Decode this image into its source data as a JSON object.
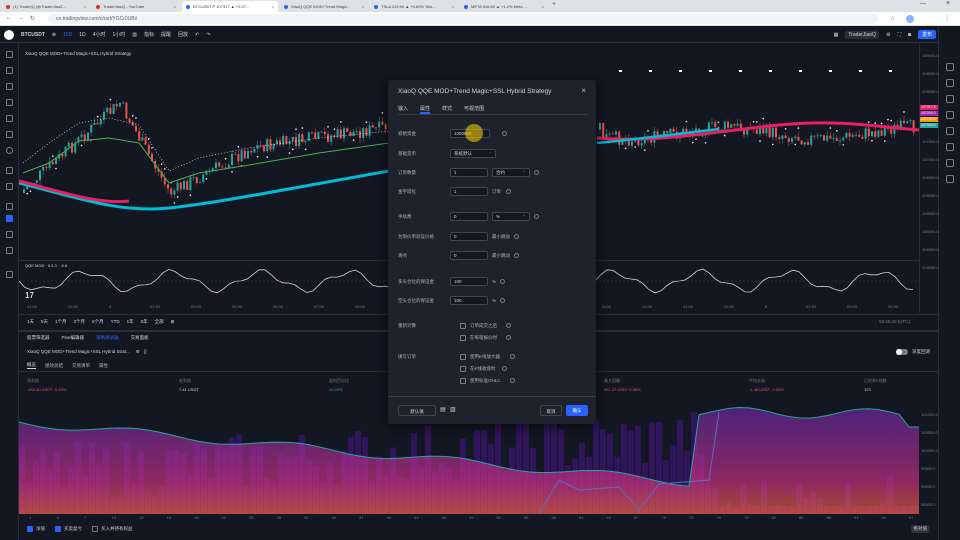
{
  "browser": {
    "tabs": [
      {
        "label": "(1) Trader|Q (@TraderJiaoZ..."
      },
      {
        "label": "TraderJiaoQ - YouTube"
      },
      {
        "label": "BTCUSDT.P 107317 ▲ +0.07..."
      },
      {
        "label": "XiaoQ QQE MOD+Trend Magic..."
      },
      {
        "label": "TSLA 219.90 ▲ +0.69% Tesl..."
      },
      {
        "label": "META 516.80 ▲ +1.2% Meta ..."
      }
    ],
    "url": "cn.tradingview.com/chart/YGCr0UBi/"
  },
  "toolbar": {
    "symbol": "BTCUSDT",
    "interval": "1D",
    "items": [
      "15D",
      "1D",
      "4小时",
      "1小时",
      "指标",
      "提醒",
      "回放"
    ],
    "account": "TraderJiaoQ",
    "publish": "发布"
  },
  "chart": {
    "indicator_legend": "XiaoQ QQE MOD+Trend Magic+SSL Hybrid Strategy",
    "osc_legend": "QQE MOD · 6 5 3 · -0.8",
    "price_labels": [
      "109000.0",
      "108500.0",
      "108000.0",
      "107500.0",
      "107000.0",
      "106500.0",
      "106000.0",
      "105500.0",
      "105000.0",
      "104500.0",
      "104000.0"
    ],
    "price_tags": [
      "107317.5",
      "107200.0",
      "107150.0",
      "107000.0"
    ],
    "time_labels": [
      "21:00",
      "22:30",
      "4",
      "01:30",
      "03:00",
      "04:30",
      "06:00",
      "07:30",
      "09:00",
      "10:30",
      "12:00",
      "13:30",
      "15:00",
      "16:30",
      "18:00",
      "19:30",
      "21:00",
      "22:30",
      "5",
      "01:30",
      "03:00",
      "04:30"
    ],
    "ranges": [
      "1天",
      "5天",
      "1个月",
      "3个月",
      "6个月",
      "YTD",
      "1年",
      "5年",
      "全部"
    ],
    "clock": "04:46:40 (UTC)"
  },
  "bottom_panel": {
    "tabs": [
      "股票筛选器",
      "Pine编辑器",
      "策略测试器",
      "交易面板"
    ],
    "strategy_name": "XiaoQ QQE MOD+Trend Magic+SSL Hybrid Strat...",
    "subtabs": [
      "概览",
      "绩效总结",
      "交易清单",
      "属性"
    ],
    "toggle_label": "深度回测",
    "metrics": [
      {
        "label": "净利润",
        "value": "-453.40 USDT -0.45%"
      },
      {
        "label": "毛利润",
        "value": "7.41 USDT"
      },
      {
        "label": "盈利百分比",
        "value": "26.09%"
      },
      {
        "label": "盈利因子",
        "value": "0.19"
      },
      {
        "label": "最大回撤",
        "value": "551.37 USDT 0.55%"
      },
      {
        "label": "平均交易",
        "value": "-1.48 USDT -0.03%"
      },
      {
        "label": "已交易K线数",
        "value": "123"
      }
    ],
    "equity_labels": [
      "101000.0",
      "100500.0",
      "100000.0",
      "99500.0",
      "99000.0",
      "98500.0"
    ],
    "equity_x": [
      "1",
      "4",
      "7",
      "10",
      "13",
      "16",
      "19",
      "22",
      "25",
      "28",
      "31",
      "34",
      "37",
      "40",
      "43",
      "46",
      "49",
      "52",
      "55",
      "58",
      "61",
      "64",
      "67",
      "70",
      "73",
      "76",
      "79",
      "82",
      "85",
      "88",
      "91",
      "94",
      "97"
    ],
    "legend": [
      "净值",
      "买卖盈亏",
      "买入并持有权益"
    ],
    "mode": "绝对值"
  },
  "dialog": {
    "title": "XiaoQ QQE MOD+Trend Magic+SSL Hybrid Strategy",
    "tabs": [
      "输入",
      "属性",
      "样式",
      "可视范围"
    ],
    "active_tab": "属性",
    "fields": [
      {
        "label": "初始资金",
        "value": "1000000"
      },
      {
        "label": "基础货币",
        "value": "系统默认"
      },
      {
        "label": "订单数量",
        "value": "1",
        "unit": "合约"
      },
      {
        "label": "金字塔化",
        "value": "1",
        "unit": "订单"
      },
      {
        "label": "手续费",
        "value": "0",
        "unit": "%"
      },
      {
        "label": "为限价单验证价格",
        "value": "0",
        "unit": "最小跳动"
      },
      {
        "label": "滑点",
        "value": "0",
        "unit": "最小跳动"
      },
      {
        "label": "多头仓位的保证金",
        "value": "100",
        "unit": "%"
      },
      {
        "label": "空头仓位的保证金",
        "value": "100",
        "unit": "%"
      }
    ],
    "recalc_label": "重新计算",
    "recalc_options": [
      "订单成交之后",
      "在每笔报价时"
    ],
    "fill_label": "填写订单",
    "fill_options": [
      "使用K线放大器",
      "在K线收盘时",
      "使用标准OHLC"
    ],
    "default_btn": "默认值",
    "cancel_btn": "取消",
    "ok_btn": "确认"
  },
  "colors": {
    "accent": "#2962ff",
    "up": "#26a69a",
    "down": "#ef5350",
    "ma_cyan": "#00bcd4",
    "ma_magenta": "#e91e63"
  }
}
